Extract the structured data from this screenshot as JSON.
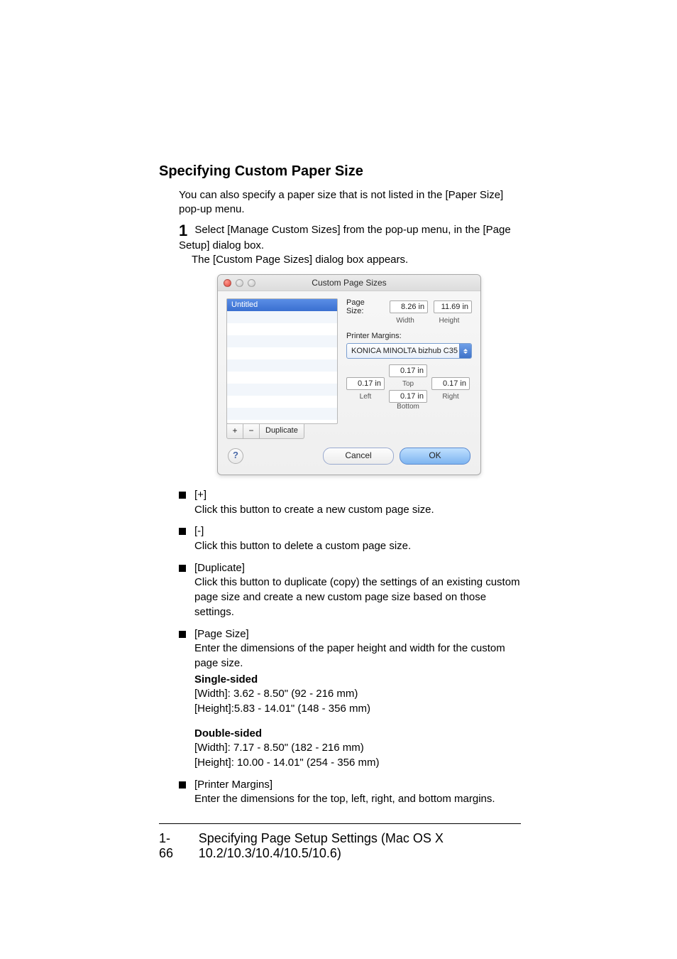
{
  "heading": "Specifying Custom Paper Size",
  "intro": "You can also specify a paper size that is not listed in the [Paper Size] pop-up menu.",
  "step": {
    "num": "1",
    "text": "Select [Manage Custom Sizes] from the pop-up menu, in the [Page Setup] dialog box.",
    "sub": "The [Custom Page Sizes] dialog box appears."
  },
  "dialog": {
    "title": "Custom Page Sizes",
    "list_selected": "Untitled",
    "btn_plus": "+",
    "btn_minus": "−",
    "btn_duplicate": "Duplicate",
    "page_size_label": "Page Size:",
    "width_value": "8.26 in",
    "height_value": "11.69 in",
    "width_label": "Width",
    "height_label": "Height",
    "printer_margins_label": "Printer Margins:",
    "margins_popup": "KONICA MINOLTA bizhub C35",
    "margin_top": "0.17 in",
    "margin_left": "0.17 in",
    "margin_right": "0.17 in",
    "margin_bottom": "0.17 in",
    "lbl_top": "Top",
    "lbl_left": "Left",
    "lbl_right": "Right",
    "lbl_bottom": "Bottom",
    "help": "?",
    "cancel": "Cancel",
    "ok": "OK"
  },
  "bullets": {
    "b1_term": "[+]",
    "b1_body": "Click this button to create a new custom page size.",
    "b2_term": "[-]",
    "b2_body": "Click this button to delete a custom page size.",
    "b3_term": "[Duplicate]",
    "b3_body": "Click this button to duplicate (copy) the settings of an existing custom page size and create a new custom page size based on those settings.",
    "b4_term": "[Page Size]",
    "b4_body": "Enter the dimensions of the paper height and width for the custom page size.",
    "b4_single_label": "Single-sided",
    "b4_single_w": "[Width]: 3.62 - 8.50\" (92 - 216 mm)",
    "b4_single_h": "[Height]:5.83 - 14.01\" (148 - 356 mm)",
    "b4_double_label": "Double-sided",
    "b4_double_w": "[Width]: 7.17 - 8.50\" (182 - 216 mm)",
    "b4_double_h": "[Height]: 10.00 - 14.01\" (254 - 356 mm)",
    "b5_term": "[Printer Margins]",
    "b5_body": "Enter the dimensions for the top, left, right, and bottom margins."
  },
  "footer": {
    "page": "1-66",
    "text": "Specifying Page Setup Settings (Mac OS X 10.2/10.3/10.4/10.5/10.6)"
  }
}
